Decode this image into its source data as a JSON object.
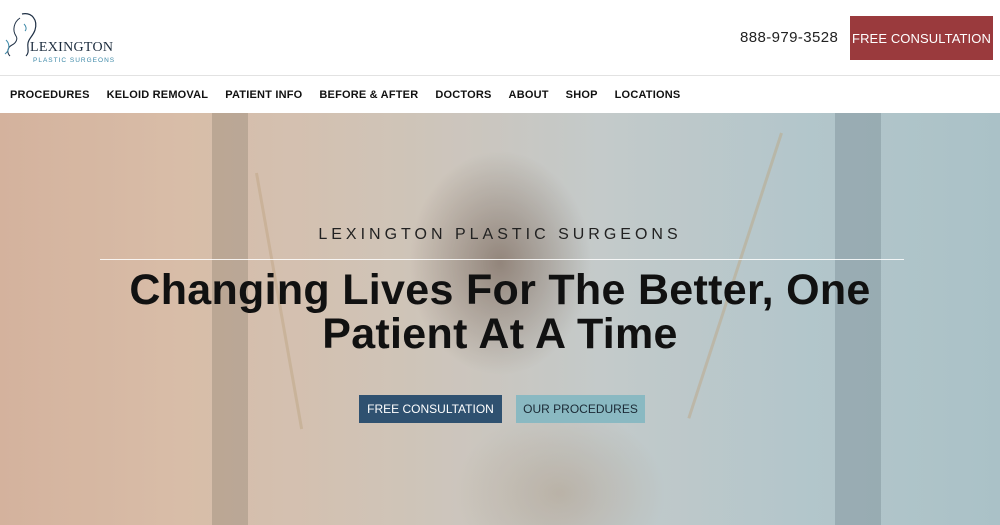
{
  "header": {
    "logo_name": "LEXINGTON",
    "logo_tagline": "PLASTIC SURGEONS",
    "phone": "888-979-3528",
    "cta_label": "FREE CONSULTATION"
  },
  "nav": {
    "items": [
      "PROCEDURES",
      "KELOID REMOVAL",
      "PATIENT INFO",
      "BEFORE & AFTER",
      "DOCTORS",
      "ABOUT",
      "SHOP",
      "LOCATIONS"
    ]
  },
  "hero": {
    "eyebrow": "LEXINGTON PLASTIC SURGEONS",
    "title": "Changing Lives For The Better, One Patient At A Time",
    "primary_button": "FREE CONSULTATION",
    "secondary_button": "OUR PROCEDURES"
  },
  "colors": {
    "cta_top": "#9a3a3d",
    "primary_button": "#2f5170",
    "secondary_button": "#8ab9c2",
    "logo_accent": "#3d89a8"
  },
  "icons": {
    "logo_mark": "face-profile-line-art"
  }
}
